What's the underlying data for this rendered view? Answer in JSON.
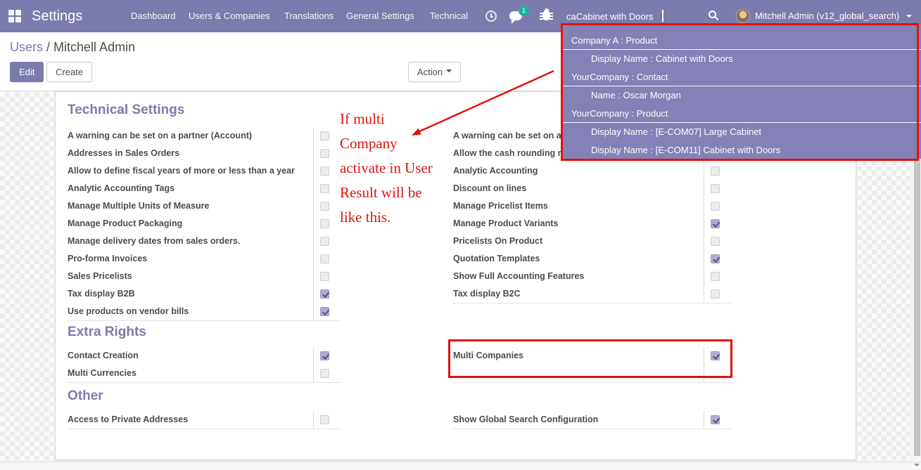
{
  "colors": {
    "accent": "#7c7bad",
    "nav_bg": "#7c7bad",
    "dd_bg": "#8381b5",
    "red": "#e0140e",
    "badge": "#1db3a1",
    "label": "#4c4c4c"
  },
  "navbar": {
    "app_title": "Settings",
    "menu_items": [
      "Dashboard",
      "Users & Companies",
      "Translations",
      "General Settings",
      "Technical"
    ],
    "message_badge": "1",
    "search_value": "caCabinet with Doors",
    "user_name": "Mitchell Admin (v12_global_search)"
  },
  "search_dropdown": {
    "groups": [
      {
        "header": "Company A : Product",
        "items": [
          "Display Name : Cabinet with Doors"
        ]
      },
      {
        "header": "YourCompany : Contact",
        "items": [
          "Name : Oscar Morgan"
        ]
      },
      {
        "header": "YourCompany : Product",
        "items": [
          "Display Name : [E-COM07] Large Cabinet",
          "Display Name : [E-COM11] Cabinet with Doors"
        ]
      }
    ]
  },
  "control_panel": {
    "breadcrumb_link": "Users",
    "breadcrumb_separator": " / ",
    "breadcrumb_current": "Mitchell Admin",
    "edit_label": "Edit",
    "create_label": "Create",
    "action_label": "Action"
  },
  "annotation": {
    "note_lines": [
      "If multi",
      "Company",
      "activate in User",
      "Result will be",
      "like this."
    ]
  },
  "sections": {
    "technical": {
      "title": "Technical Settings",
      "left": [
        {
          "label": "A warning can be set on a partner (Account)",
          "checked": false
        },
        {
          "label": "Addresses in Sales Orders",
          "checked": false
        },
        {
          "label": "Allow to define fiscal years of more or less than a year",
          "checked": false
        },
        {
          "label": "Analytic Accounting Tags",
          "checked": false
        },
        {
          "label": "Manage Multiple Units of Measure",
          "checked": false
        },
        {
          "label": "Manage Product Packaging",
          "checked": false
        },
        {
          "label": "Manage delivery dates from sales orders.",
          "checked": false
        },
        {
          "label": "Pro-forma Invoices",
          "checked": false
        },
        {
          "label": "Sales Pricelists",
          "checked": false
        },
        {
          "label": "Tax display B2B",
          "checked": true
        },
        {
          "label": "Use products on vendor bills",
          "checked": true
        }
      ],
      "right": [
        {
          "label": "A warning can be set on a",
          "checked": false
        },
        {
          "label": "Allow the cash rounding m",
          "checked": false
        },
        {
          "label": "Analytic Accounting",
          "checked": false
        },
        {
          "label": "Discount on lines",
          "checked": false
        },
        {
          "label": "Manage Pricelist Items",
          "checked": false
        },
        {
          "label": "Manage Product Variants",
          "checked": true
        },
        {
          "label": "Pricelists On Product",
          "checked": false
        },
        {
          "label": "Quotation Templates",
          "checked": true
        },
        {
          "label": "Show Full Accounting Features",
          "checked": false
        },
        {
          "label": "Tax display B2C",
          "checked": false
        }
      ]
    },
    "extra_rights": {
      "title": "Extra Rights",
      "left": [
        {
          "label": "Contact Creation",
          "checked": true
        },
        {
          "label": "Multi Currencies",
          "checked": false
        }
      ],
      "right": [
        {
          "label": "Multi Companies",
          "checked": true
        },
        {
          "label": "",
          "checked": null
        }
      ]
    },
    "other": {
      "title": "Other",
      "left": [
        {
          "label": "Access to Private Addresses",
          "checked": false
        }
      ],
      "right": [
        {
          "label": "Show Global Search Configuration",
          "checked": true
        }
      ]
    }
  }
}
